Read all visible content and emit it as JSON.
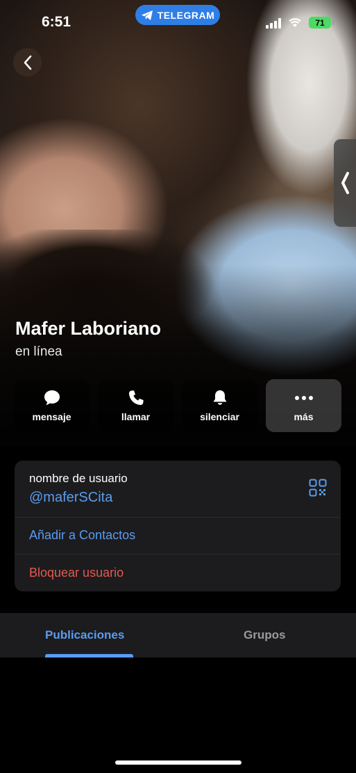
{
  "status_bar": {
    "time": "6:51",
    "app_pill": "TELEGRAM",
    "battery": "71"
  },
  "profile": {
    "name": "Mafer Laboriano",
    "status": "en línea"
  },
  "actions": [
    {
      "label": "mensaje",
      "icon": "chat-bubble-icon"
    },
    {
      "label": "llamar",
      "icon": "phone-icon"
    },
    {
      "label": "silenciar",
      "icon": "bell-icon"
    },
    {
      "label": "más",
      "icon": "more-icon"
    }
  ],
  "info": {
    "username_caption": "nombre de usuario",
    "username": "@maferSCita",
    "add_contact": "Añadir a Contactos",
    "block_user": "Bloquear usuario"
  },
  "tabs": [
    {
      "label": "Publicaciones",
      "active": true
    },
    {
      "label": "Grupos",
      "active": false
    }
  ],
  "colors": {
    "accent": "#5a9cf0",
    "danger": "#e5584f",
    "card": "#1c1c1e",
    "pill": "#2f7ee6",
    "battery": "#4cd964"
  }
}
